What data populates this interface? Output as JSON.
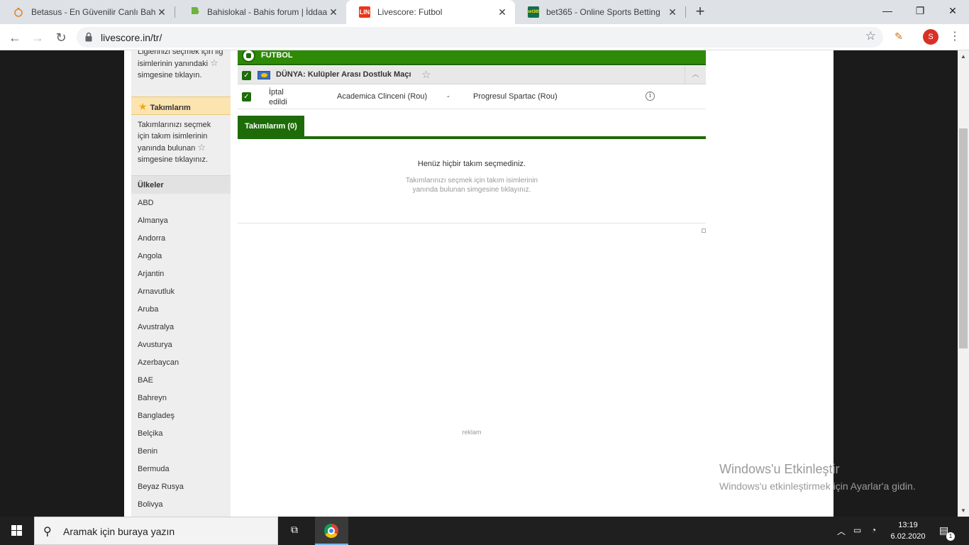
{
  "browser": {
    "tabs": [
      {
        "title": "Betasus - En Güvenilir Canlı Bahis",
        "favicon": "betasus-icon"
      },
      {
        "title": "Bahislokal - Bahis forum | İddaa t",
        "favicon": "bahislokal-icon"
      },
      {
        "title": "Livescore: Futbol",
        "favicon": "livescore-icon",
        "favicon_text": "LIN",
        "active": true
      },
      {
        "title": "bet365 - Online Sports Betting",
        "favicon": "bet365-icon",
        "favicon_text": "bet365"
      }
    ],
    "url": "livescore.in/tr/",
    "profile_initial": "S"
  },
  "sidebar": {
    "leagues_hint_cut": "Liglerinizi seçmek için lig",
    "leagues_hint_line2": "isimlerinin yanındaki",
    "leagues_hint_line3": "simgesine tıklayın.",
    "my_teams_label": "Takımlarım",
    "my_teams_hint_1": "Takımlarınızı seçmek için takım isimlerinin yanında bulunan",
    "my_teams_hint_2": "simgesine tıklayınız.",
    "countries_label": "Ülkeler",
    "countries": [
      "ABD",
      "Almanya",
      "Andorra",
      "Angola",
      "Arjantin",
      "Arnavutluk",
      "Aruba",
      "Avustralya",
      "Avusturya",
      "Azerbaycan",
      "BAE",
      "Bahreyn",
      "Bangladeş",
      "Belçika",
      "Benin",
      "Bermuda",
      "Beyaz Rusya",
      "Bolivya"
    ]
  },
  "main": {
    "sport_label": "FUTBOL",
    "league_name": "DÜNYA: Kulüpler Arası Dostluk Maçı",
    "match": {
      "status": "İptal edildi",
      "home": "Academica Clinceni (Rou)",
      "separator": "-",
      "away": "Progresul Spartac (Rou)"
    },
    "my_teams_tab": "Takımlarım (0)",
    "empty_title": "Henüz hiçbir takım seçmediniz.",
    "empty_hint": "Takımlarınızı seçmek için takım isimlerinin yanında bulunan simgesine tıklayınız.",
    "ad_label": "reklam"
  },
  "watermark": {
    "line1": "Windows'u Etkinleştir",
    "line2": "Windows'u etkinleştirmek için Ayarlar'a gidin."
  },
  "taskbar": {
    "search_placeholder": "Aramak için buraya yazın",
    "time": "13:19",
    "date": "6.02.2020",
    "notification_count": "1"
  },
  "colors": {
    "accent_green": "#2e8a06",
    "dark_green": "#1e6b0a",
    "my_teams_bg": "#fce4b0"
  }
}
